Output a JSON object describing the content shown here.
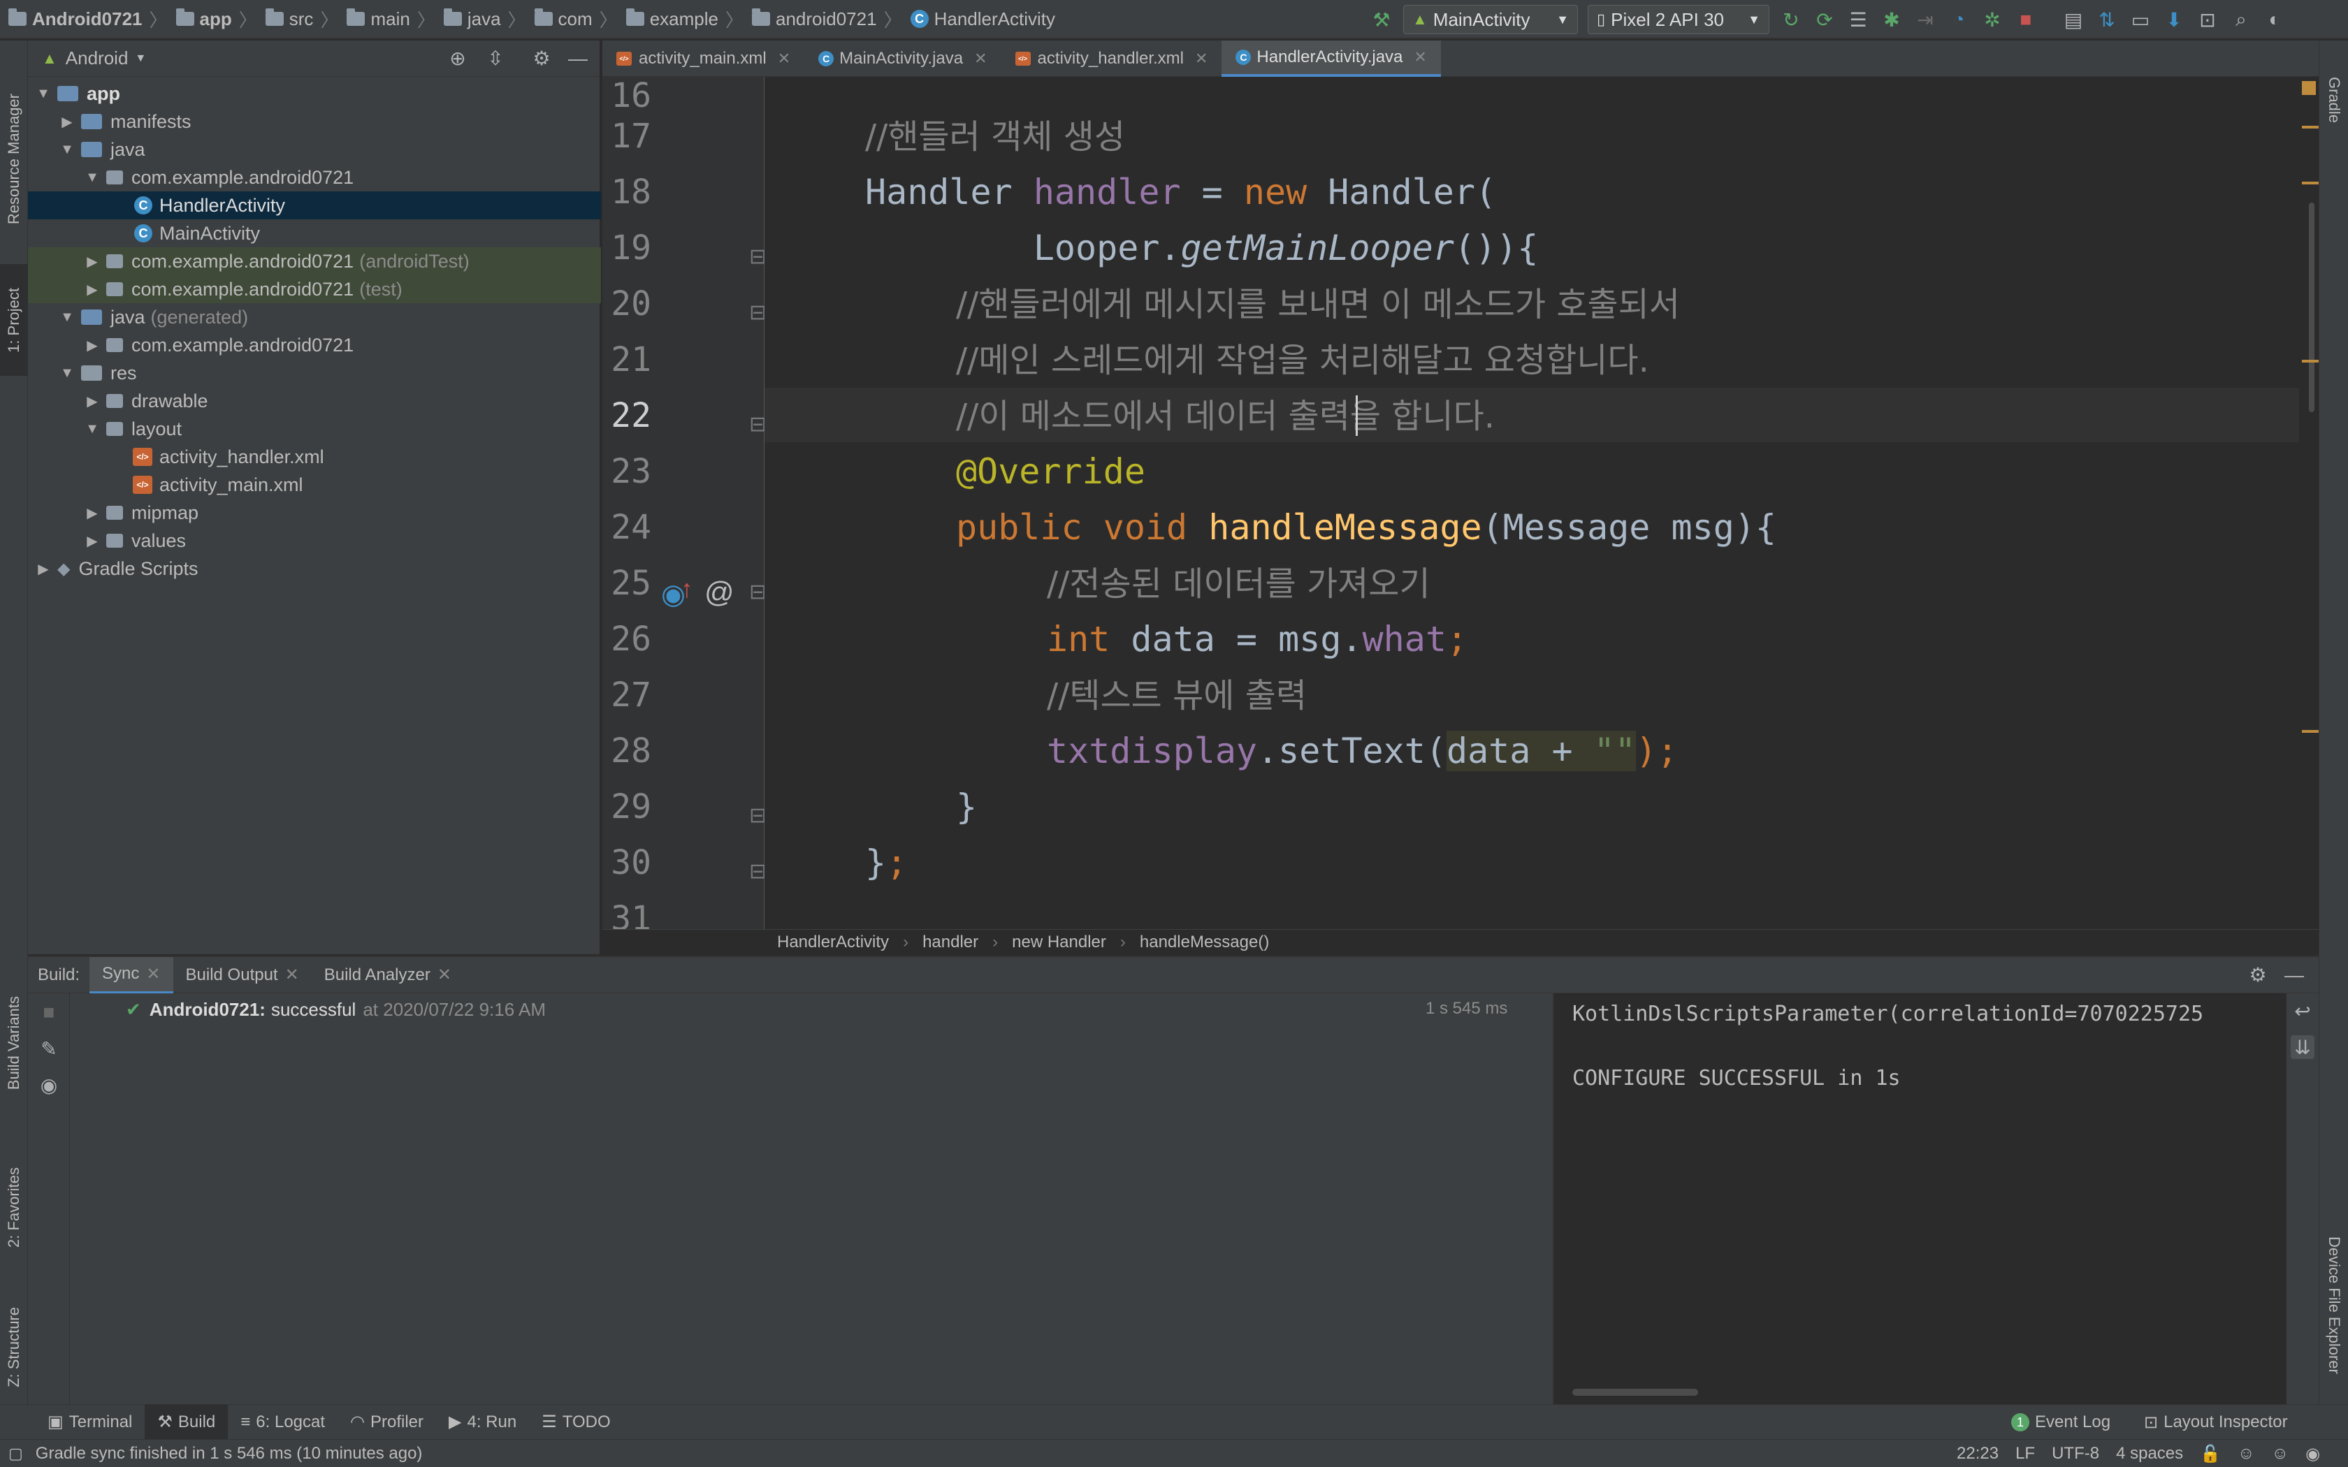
{
  "breadcrumb": [
    "Android0721",
    "app",
    "src",
    "main",
    "java",
    "com",
    "example",
    "android0721",
    "HandlerActivity"
  ],
  "toolbar": {
    "run_config": "MainActivity",
    "device": "Pixel 2 API 30"
  },
  "left_strip": {
    "resource_manager": "Resource Manager",
    "project": "1: Project",
    "build_variants": "Build Variants",
    "favorites": "2: Favorites",
    "structure": "Z: Structure"
  },
  "right_strip": {
    "gradle": "Gradle",
    "device_file_explorer": "Device File Explorer"
  },
  "project": {
    "view_mode": "Android",
    "tree": [
      {
        "label": "app",
        "dim": ""
      },
      {
        "label": "manifests",
        "dim": ""
      },
      {
        "label": "java",
        "dim": ""
      },
      {
        "label": "com.example.android0721",
        "dim": ""
      },
      {
        "label": "HandlerActivity",
        "dim": ""
      },
      {
        "label": "MainActivity",
        "dim": ""
      },
      {
        "label": "com.example.android0721",
        "dim": "(androidTest)"
      },
      {
        "label": "com.example.android0721",
        "dim": "(test)"
      },
      {
        "label": "java",
        "dim": "(generated)"
      },
      {
        "label": "com.example.android0721",
        "dim": ""
      },
      {
        "label": "res",
        "dim": ""
      },
      {
        "label": "drawable",
        "dim": ""
      },
      {
        "label": "layout",
        "dim": ""
      },
      {
        "label": "activity_handler.xml",
        "dim": ""
      },
      {
        "label": "activity_main.xml",
        "dim": ""
      },
      {
        "label": "mipmap",
        "dim": ""
      },
      {
        "label": "values",
        "dim": ""
      },
      {
        "label": "Gradle Scripts",
        "dim": ""
      }
    ]
  },
  "tabs": [
    {
      "label": "activity_main.xml"
    },
    {
      "label": "MainActivity.java"
    },
    {
      "label": "activity_handler.xml"
    },
    {
      "label": "HandlerActivity.java"
    }
  ],
  "editor": {
    "line_numbers": [
      "16",
      "17",
      "18",
      "19",
      "20",
      "21",
      "22",
      "23",
      "24",
      "25",
      "26",
      "27",
      "28",
      "29",
      "30",
      "31"
    ],
    "lines": {
      "l17": "//핸들러 객체 생성",
      "l18a": "Handler ",
      "l18b": "handler",
      "l18c": " = ",
      "l18d": "new",
      "l18e": " Handler(",
      "l19a": "        Looper.",
      "l19b": "getMainLooper",
      "l19c": "()){",
      "l20": "//핸들러에게 메시지를 보내면 이 메소드가 호출되서",
      "l21": "//메인 스레드에게 작업을 처리해달고 요청합니다.",
      "l22": "//이 메소드에서 데이터 출력을 합니다.",
      "l23": "@Override",
      "l24a": "public void ",
      "l24b": "handleMessage",
      "l24c": "(Message msg){",
      "l25": "//전송된 데이터를 가져오기",
      "l26a": "int",
      "l26b": " data = msg.",
      "l26c": "what",
      "l26d": ";",
      "l27": "//텍스트 뷰에 출력",
      "l28a": "txtdisplay",
      "l28b": ".setText(",
      "l28c": "data + ",
      "l28d": "\"\"",
      "l28e": ");",
      "l29": "}",
      "l30a": "}",
      "l30b": ";"
    },
    "crumbs": [
      "HandlerActivity",
      "handler",
      "new Handler",
      "handleMessage()"
    ]
  },
  "build": {
    "label": "Build:",
    "tabs": [
      "Sync",
      "Build Output",
      "Build Analyzer"
    ],
    "result_name": "Android0721:",
    "result_status": "successful",
    "result_time": "at 2020/07/22 9:16 AM",
    "duration": "1 s 545 ms",
    "console_line1": "KotlinDslScriptsParameter(correlationId=7070225725",
    "console_line2": "CONFIGURE SUCCESSFUL in 1s"
  },
  "bottom_tools": {
    "terminal": "Terminal",
    "build": "Build",
    "logcat": "6: Logcat",
    "profiler": "Profiler",
    "run": "4: Run",
    "todo": "TODO",
    "event_log": "Event Log",
    "event_log_count": "1",
    "layout_inspector": "Layout Inspector"
  },
  "status": {
    "message": "Gradle sync finished in 1 s 546 ms (10 minutes ago)",
    "position": "22:23",
    "line_sep": "LF",
    "encoding": "UTF-8",
    "indent": "4 spaces"
  }
}
